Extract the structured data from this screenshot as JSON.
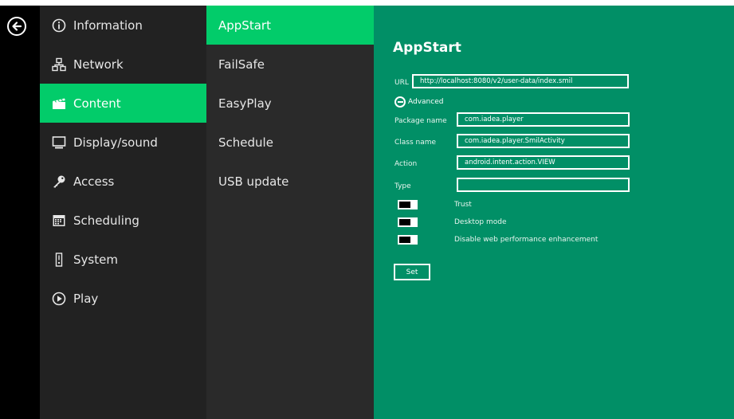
{
  "menu": {
    "items": [
      {
        "label": "Information",
        "icon": "info-icon"
      },
      {
        "label": "Network",
        "icon": "network-icon"
      },
      {
        "label": "Content",
        "icon": "clapperboard-icon"
      },
      {
        "label": "Display/sound",
        "icon": "monitor-icon"
      },
      {
        "label": "Access",
        "icon": "key-icon"
      },
      {
        "label": "Scheduling",
        "icon": "calendar-icon"
      },
      {
        "label": "System",
        "icon": "system-icon"
      },
      {
        "label": "Play",
        "icon": "play-icon"
      }
    ],
    "active_index": 2
  },
  "submenu": {
    "items": [
      {
        "label": "AppStart"
      },
      {
        "label": "FailSafe"
      },
      {
        "label": "EasyPlay"
      },
      {
        "label": "Schedule"
      },
      {
        "label": "USB update"
      }
    ],
    "active_index": 0
  },
  "panel": {
    "title": "AppStart",
    "url_label": "URL",
    "url_value": "http://localhost:8080/v2/user-data/index.smil",
    "advanced_label": "Advanced",
    "package_label": "Package name",
    "package_value": "com.iadea.player",
    "class_label": "Class name",
    "class_value": "com.iadea.player.SmilActivity",
    "action_label": "Action",
    "action_value": "android.intent.action.VIEW",
    "type_label": "Type",
    "type_value": "",
    "toggles": [
      {
        "label": "Trust",
        "on": false
      },
      {
        "label": "Desktop mode",
        "on": false
      },
      {
        "label": "Disable web performance enhancement",
        "on": false
      }
    ],
    "set_label": "Set"
  },
  "colors": {
    "accent": "#02cc6a",
    "panel_bg": "#018f66",
    "menu_bg": "#222222",
    "submenu_bg": "#2a2a2a",
    "rail_bg": "#000000"
  }
}
